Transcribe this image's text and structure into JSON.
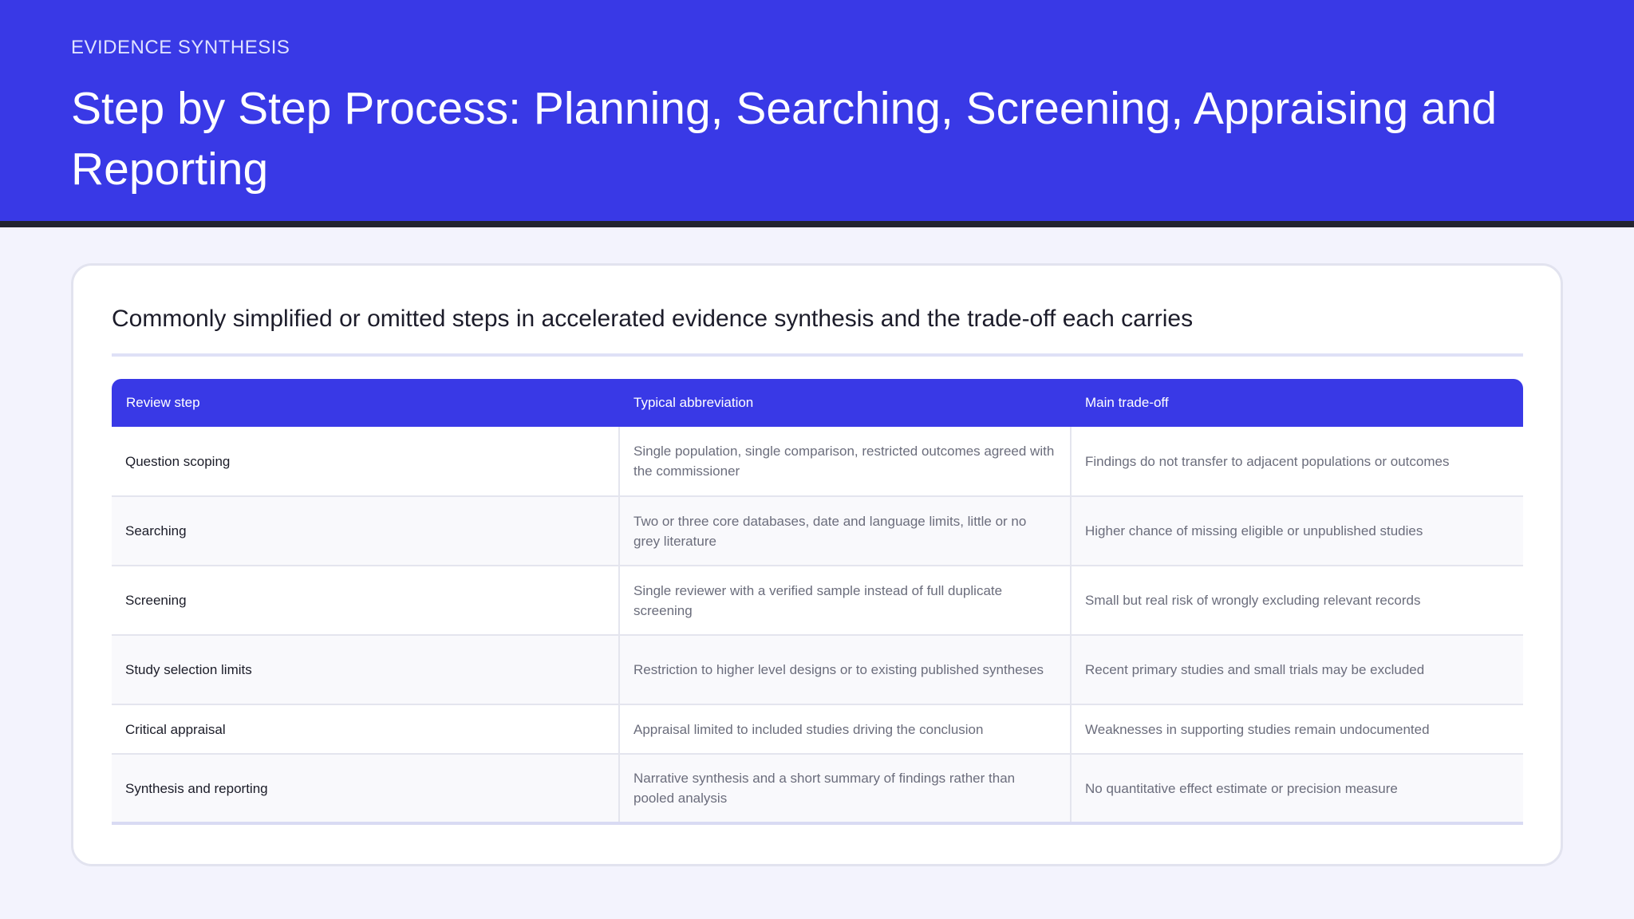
{
  "header": {
    "eyebrow": "EVIDENCE SYNTHESIS",
    "title": "Step by Step Process: Planning, Searching, Screening, Appraising and Reporting"
  },
  "card": {
    "title": "Commonly simplified or omitted steps in accelerated evidence synthesis and the trade-off each carries"
  },
  "table": {
    "columns": [
      "Review step",
      "Typical abbreviation",
      "Main trade-off"
    ],
    "rows": [
      [
        "Question scoping",
        "Single population, single comparison, restricted outcomes agreed with the commissioner",
        "Findings do not transfer to adjacent populations or outcomes"
      ],
      [
        "Searching",
        "Two or three core databases, date and language limits, little or no grey literature",
        "Higher chance of missing eligible or unpublished studies"
      ],
      [
        "Screening",
        "Single reviewer with a verified sample instead of full duplicate screening",
        "Small but real risk of wrongly excluding relevant records"
      ],
      [
        "Study selection limits",
        "Restriction to higher level designs or to existing published syntheses",
        "Recent primary studies and small trials may be excluded"
      ],
      [
        "Critical appraisal",
        "Appraisal limited to included studies driving the conclusion",
        "Weaknesses in supporting studies remain undocumented"
      ],
      [
        "Synthesis and reporting",
        "Narrative synthesis and a short summary of findings rather than pooled analysis",
        "No quantitative effect estimate or precision measure"
      ]
    ]
  },
  "colors": {
    "header_bg": "#3939e6",
    "header_rule": "#23242f",
    "page_bg": "#f3f3fd"
  }
}
